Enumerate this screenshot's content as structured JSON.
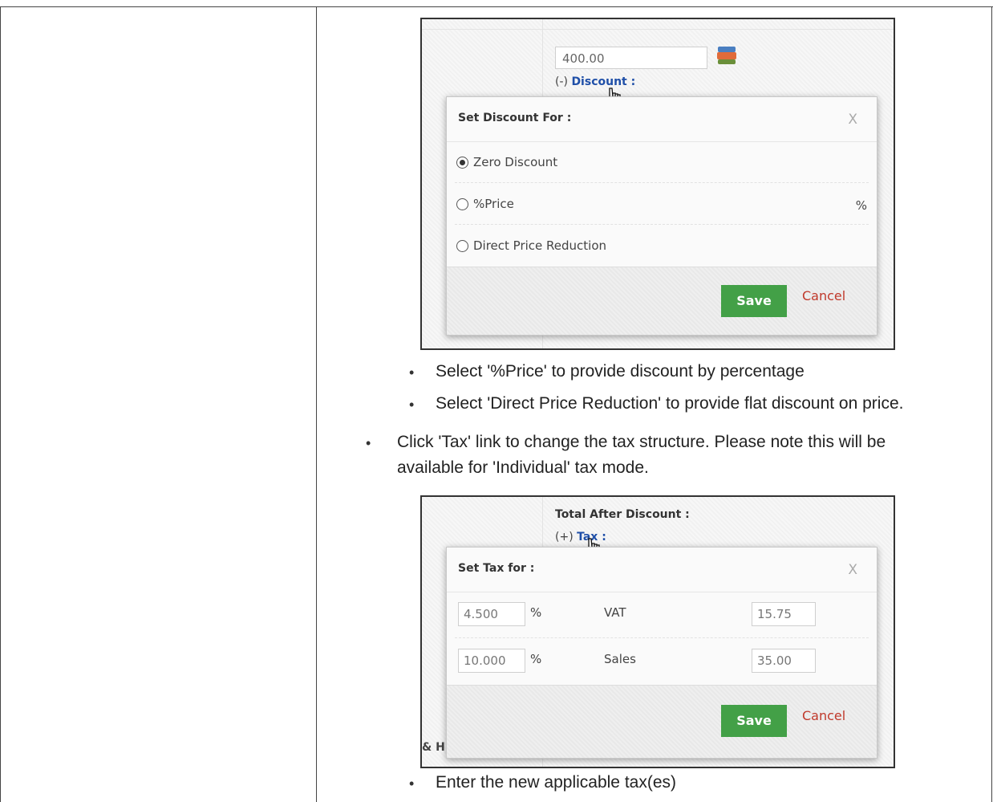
{
  "screenshot1": {
    "price_value": "400.00",
    "discount_prefix": "(-)",
    "discount_link": "Discount :",
    "popup": {
      "title": "Set Discount For :",
      "close": "X",
      "options": [
        {
          "label": "Zero Discount",
          "selected": true
        },
        {
          "label": "%Price",
          "selected": false
        },
        {
          "label": "Direct Price Reduction",
          "selected": false
        }
      ],
      "percent_suffix": "%",
      "save": "Save",
      "cancel": "Cancel"
    }
  },
  "bullets_a": [
    "Select '%Price' to provide discount by percentage",
    "Select 'Direct Price Reduction' to provide flat discount on price."
  ],
  "bullet_b_line1": "Click 'Tax' link to change the tax structure. Please note this will be",
  "bullet_b_line2": "available for 'Individual' tax mode.",
  "screenshot2": {
    "total_after_discount": "Total After Discount :",
    "tax_prefix": "(+)",
    "tax_link": "Tax :",
    "bottom_left_text": "& H",
    "popup": {
      "title": "Set Tax for :",
      "close": "X",
      "rows": [
        {
          "rate": "4.500",
          "pct": "%",
          "name": "VAT",
          "amount": "15.75"
        },
        {
          "rate": "10.000",
          "pct": "%",
          "name": "Sales",
          "amount": "35.00"
        }
      ],
      "save": "Save",
      "cancel": "Cancel"
    }
  },
  "bullet_c": "Enter the new applicable tax(es)",
  "colors": {
    "save_green": "#43a047",
    "cancel_red": "#c0392b",
    "link_blue": "#1f4fa8"
  }
}
